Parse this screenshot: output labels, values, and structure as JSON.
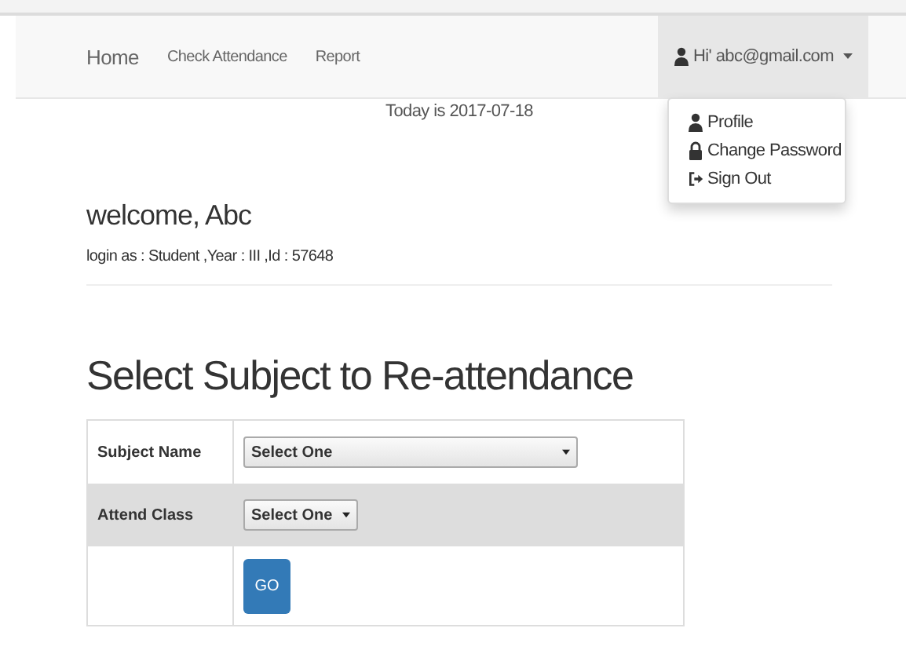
{
  "navbar": {
    "links": [
      "Home",
      "Check Attendance",
      "Report"
    ],
    "user_menu": {
      "label": "Hi' abc@gmail.com",
      "expanded": true,
      "items": [
        {
          "kind": "profile",
          "label": "Profile"
        },
        {
          "kind": "password",
          "label": "Change Password"
        },
        {
          "kind": "signout",
          "label": "Sign Out"
        }
      ]
    }
  },
  "date_text": "Today is 2017-07-18",
  "welcome": "welcome, Abc",
  "login_info": "login as : Student ,Year : III ,Id : 57648",
  "heading": "Select Subject to Re-attendance",
  "form": {
    "rows": [
      {
        "kind": "select",
        "label": "Subject Name",
        "value": "Select One"
      },
      {
        "kind": "select-small",
        "label": "Attend Class",
        "value": "Select One"
      },
      {
        "kind": "button",
        "label": "GO"
      }
    ]
  }
}
